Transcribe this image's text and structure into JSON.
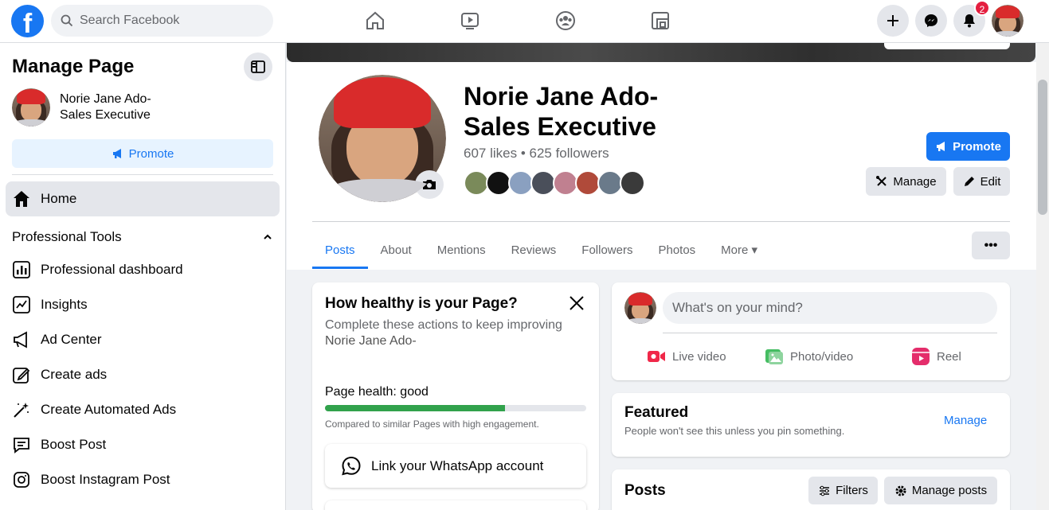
{
  "topbar": {
    "logo": "f",
    "search_placeholder": "Search Facebook",
    "nav_icons": [
      "home-icon",
      "watch-icon",
      "groups-icon",
      "gaming-icon"
    ],
    "notification_count": "2"
  },
  "sidebar": {
    "title": "Manage Page",
    "page_name_line1": "Norie Jane Ado-",
    "page_name_line2": "Sales Executive",
    "promote_label": "Promote",
    "home_label": "Home",
    "section_label": "Professional Tools",
    "items": [
      {
        "label": "Professional dashboard",
        "icon": "dashboard-icon"
      },
      {
        "label": "Insights",
        "icon": "insights-icon"
      },
      {
        "label": "Ad Center",
        "icon": "megaphone-icon"
      },
      {
        "label": "Create ads",
        "icon": "pencil-icon"
      },
      {
        "label": "Create Automated Ads",
        "icon": "magic-wand-icon"
      },
      {
        "label": "Boost Post",
        "icon": "boost-icon"
      },
      {
        "label": "Boost Instagram Post",
        "icon": "instagram-icon"
      }
    ]
  },
  "profile": {
    "name_line1": "Norie Jane Ado-",
    "name_line2": "Sales Executive",
    "stats": "607 likes • 625 followers",
    "promote_label": "Promote",
    "manage_label": "Manage",
    "edit_label": "Edit",
    "follower_colors": [
      "#7a8a5a",
      "#111111",
      "#8aa0c0",
      "#4a4f5a",
      "#c08090",
      "#b04a3a",
      "#6a7a8a",
      "#3a3a3a"
    ]
  },
  "tabs": [
    {
      "label": "Posts",
      "active": true
    },
    {
      "label": "About"
    },
    {
      "label": "Mentions"
    },
    {
      "label": "Reviews"
    },
    {
      "label": "Followers"
    },
    {
      "label": "Photos"
    },
    {
      "label": "More ▾"
    }
  ],
  "health": {
    "title": "How healthy is your Page?",
    "desc": "Complete these actions to keep improving",
    "page_name": "Norie Jane Ado-",
    "status": "Page health: good",
    "progress": 0.69,
    "compare": "Compared to similar Pages with high engagement.",
    "whatsapp_label": "Link your WhatsApp account"
  },
  "composer": {
    "placeholder": "What's on your mind?",
    "live": "Live video",
    "photo": "Photo/video",
    "reel": "Reel"
  },
  "featured": {
    "title": "Featured",
    "desc": "People won't see this unless you pin something.",
    "manage": "Manage"
  },
  "posts": {
    "title": "Posts",
    "filters": "Filters",
    "manage_posts": "Manage posts"
  },
  "colors": {
    "brand": "#1877f2",
    "health_good": "#31a24c",
    "badge": "#e41e3f"
  }
}
